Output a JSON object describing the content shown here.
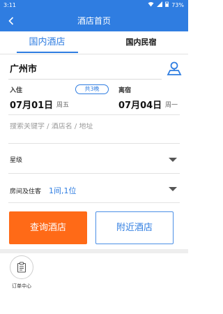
{
  "status_bar": {
    "time": "3:11",
    "battery": "73%"
  },
  "nav": {
    "title": "酒店首页"
  },
  "tabs": [
    {
      "label": "国内酒店",
      "active": true
    },
    {
      "label": "国内民宿",
      "active": false
    }
  ],
  "city": {
    "name": "广州市"
  },
  "dates": {
    "checkin_label": "入住",
    "checkin_date": "07月01日",
    "checkin_weekday": "周五",
    "nights": "共3晚",
    "checkout_label": "离宿",
    "checkout_date": "07月04日",
    "checkout_weekday": "周一"
  },
  "search": {
    "placeholder": "搜索关键字 / 酒店名 / 地址",
    "value": ""
  },
  "star": {
    "label": "星级",
    "value": ""
  },
  "room": {
    "label": "房间及住客",
    "value": "1间,1位"
  },
  "buttons": {
    "search": "查询酒店",
    "nearby": "附近酒店"
  },
  "shortcuts": [
    {
      "label": "订单中心",
      "icon": "clipboard-icon"
    }
  ],
  "colors": {
    "primary": "#2f7de1",
    "accent": "#ff6a17"
  }
}
